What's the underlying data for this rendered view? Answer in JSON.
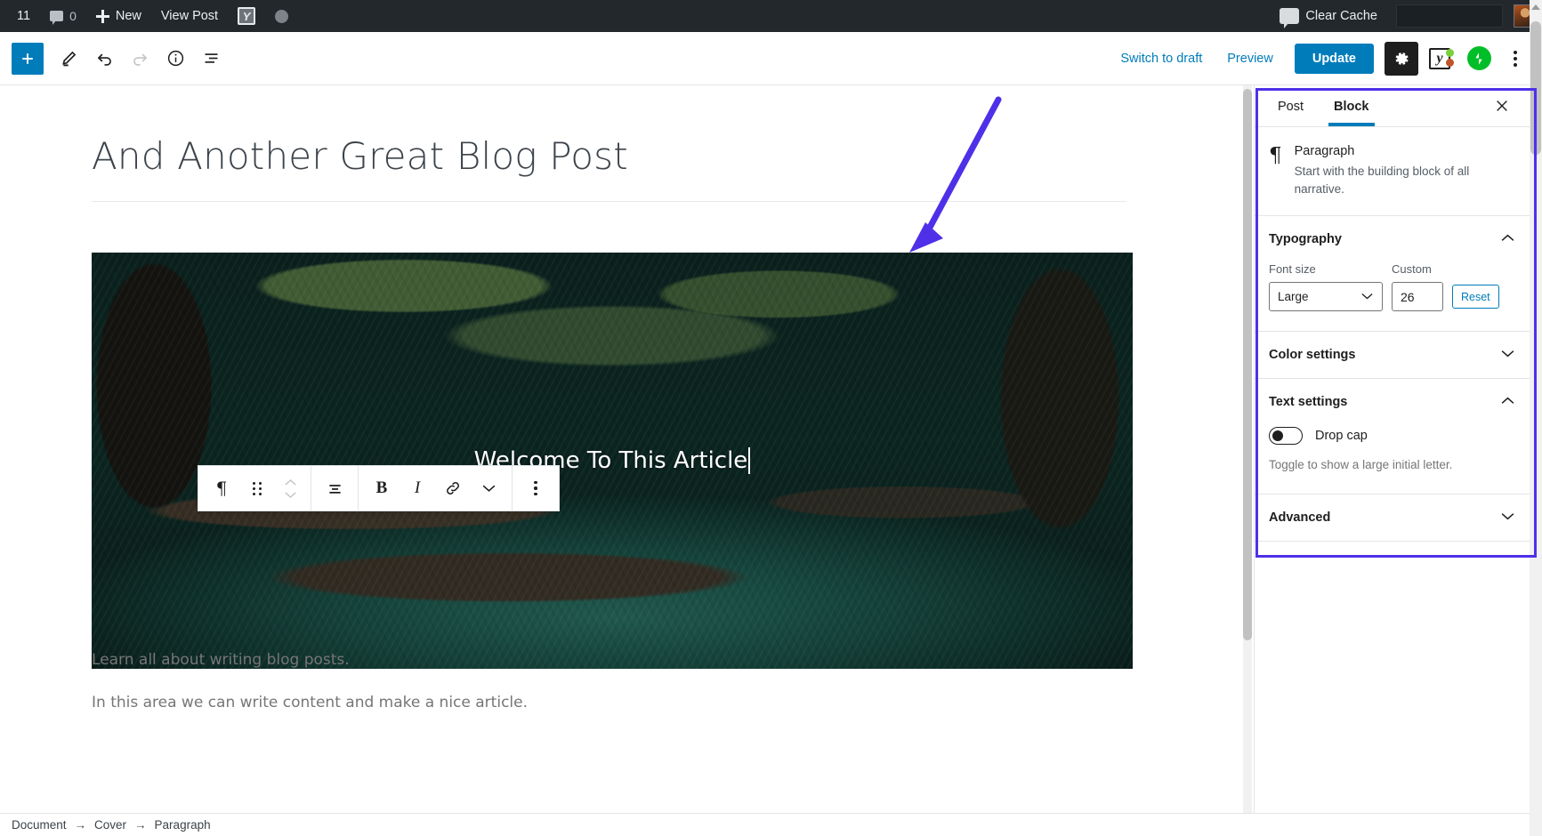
{
  "adminbar": {
    "site_count": "11",
    "comment_icon": "comment-bubble-icon",
    "comment_count": "0",
    "new_label": "New",
    "view_post_label": "View Post",
    "yoast_icon": "yoast-seo-icon",
    "status_icon": "status-dot-icon",
    "clear_cache_icon": "speech-bubble-icon",
    "clear_cache_label": "Clear Cache",
    "avatar": "user-avatar"
  },
  "editor_header": {
    "add_block_icon": "plus-icon",
    "edit_mode_icon": "pencil-icon",
    "undo_icon": "undo-arrow-icon",
    "redo_icon": "redo-arrow-icon",
    "info_icon": "info-circle-icon",
    "list_view_icon": "list-view-icon",
    "switch_to_draft_label": "Switch to draft",
    "preview_label": "Preview",
    "update_label": "Update",
    "settings_icon": "gear-icon",
    "yoast_icon": "yoast-seo-icon",
    "jetpack_icon": "jetpack-icon",
    "more_icon": "kebab-menu-icon"
  },
  "canvas": {
    "post_title": "And Another Great Blog Post",
    "cover_text": "Welcome To This Article",
    "paragraph_1": "Learn all about writing blog posts.",
    "paragraph_2": "In this area we can write content and make a nice article."
  },
  "block_toolbar": {
    "block_type_icon": "paragraph-pilcrow-icon",
    "drag_icon": "drag-handle-icon",
    "move_icon": "move-up-down-icon",
    "align_icon": "align-center-icon",
    "bold_label": "B",
    "italic_label": "I",
    "link_icon": "link-icon",
    "more_rich_text_icon": "chevron-down-icon",
    "options_icon": "kebab-menu-icon"
  },
  "sidebar": {
    "tabs": [
      {
        "label": "Post",
        "active": false
      },
      {
        "label": "Block",
        "active": true
      }
    ],
    "close_icon": "close-x-icon",
    "block_info": {
      "icon": "paragraph-pilcrow-icon",
      "title": "Paragraph",
      "description": "Start with the building block of all narrative."
    },
    "panels": [
      {
        "title": "Typography",
        "expanded": true
      },
      {
        "title": "Color settings",
        "expanded": false
      },
      {
        "title": "Text settings",
        "expanded": true
      },
      {
        "title": "Advanced",
        "expanded": false
      }
    ],
    "typography": {
      "font_size_label": "Font size",
      "font_size_value": "Large",
      "custom_label": "Custom",
      "custom_value": "26",
      "reset_label": "Reset"
    },
    "text_settings": {
      "drop_cap_label": "Drop cap",
      "drop_cap_on": false,
      "helper_text": "Toggle to show a large initial letter."
    }
  },
  "footer": {
    "breadcrumb": [
      "Document",
      "Cover",
      "Paragraph"
    ],
    "separator": "→"
  },
  "annotation": {
    "color": "#4f30e8",
    "shape": "arrow-pointing-to-block-sidebar"
  },
  "colors": {
    "accent_blue": "#007cba",
    "adminbar_bg": "#23282d",
    "annotation_purple": "#4f30e8",
    "jetpack_green": "#00be28"
  }
}
